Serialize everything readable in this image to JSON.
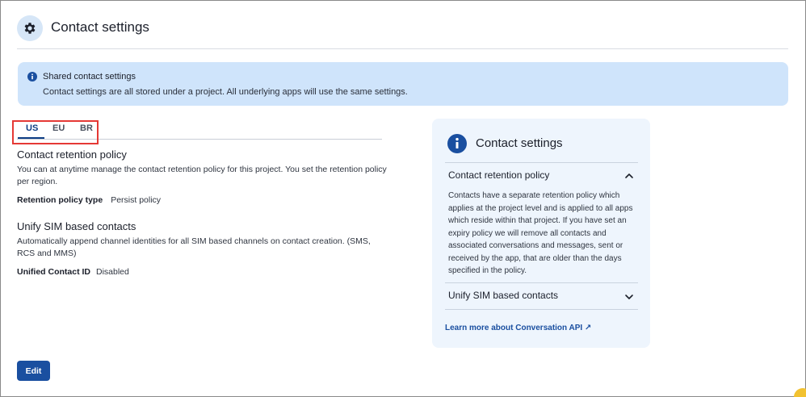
{
  "header": {
    "title": "Contact settings",
    "icon": "gear-icon"
  },
  "banner": {
    "title": "Shared contact settings",
    "text": "Contact settings are all stored under a project. All underlying apps will use the same settings.",
    "icon": "info-icon"
  },
  "tabs": [
    {
      "label": "US",
      "active": true
    },
    {
      "label": "EU",
      "active": false
    },
    {
      "label": "BR",
      "active": false
    }
  ],
  "retention": {
    "title": "Contact retention policy",
    "desc": "You can at anytime manage the contact retention policy for this project. You set the retention policy per region.",
    "key": "Retention policy type",
    "value": "Persist policy"
  },
  "unify": {
    "title": "Unify SIM based contacts",
    "desc": "Automatically append channel identities for all SIM based channels on contact creation. (SMS, RCS and MMS)",
    "key": "Unified Contact ID",
    "value": "Disabled"
  },
  "edit_label": "Edit",
  "panel": {
    "title": "Contact settings",
    "icon": "info-icon",
    "accordions": [
      {
        "title": "Contact retention policy",
        "expanded": true,
        "body": "Contacts have a separate retention policy which applies at the project level and is applied to all apps which reside within that project. If you have set an expiry policy we will remove all contacts and associated conversations and messages, sent or received by the app, that are older than the days specified in the policy."
      },
      {
        "title": "Unify SIM based contacts",
        "expanded": false
      }
    ],
    "link": "Learn more about Conversation API ↗"
  },
  "colors": {
    "accent": "#1a4fa0",
    "banner_bg": "#cfe4fb",
    "panel_bg": "#eef5fd",
    "highlight": "#e53935"
  }
}
